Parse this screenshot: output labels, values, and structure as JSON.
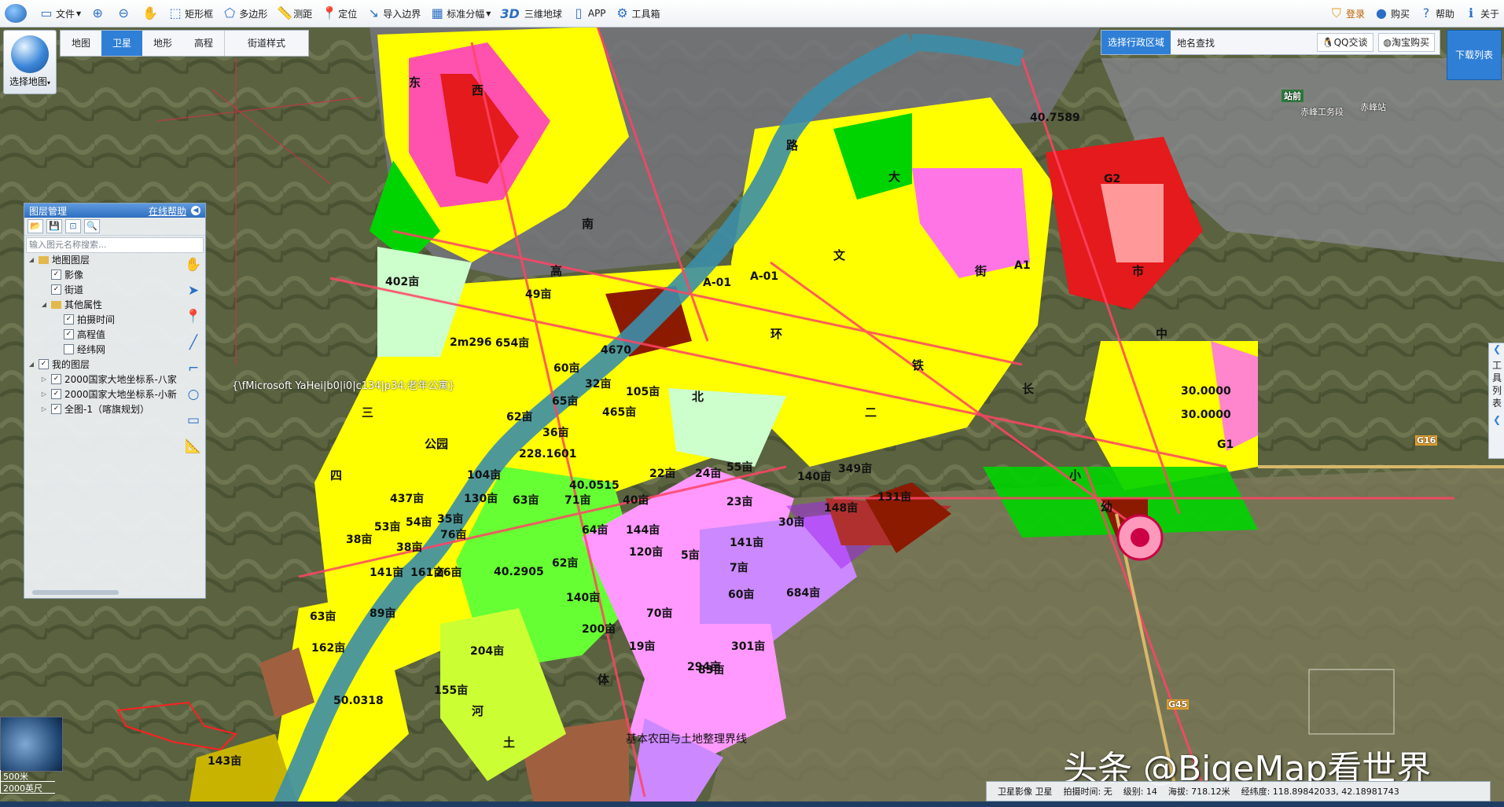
{
  "toolbar": {
    "file": "文件",
    "rect": "矩形框",
    "polygon": "多边形",
    "measure": "测距",
    "locate": "定位",
    "import_border": "导入边界",
    "standard_sheet": "标准分幅",
    "three_d_badge": "3D",
    "three_d_globe": "三维地球",
    "app": "APP",
    "toolbox": "工具箱",
    "login": "登录",
    "buy": "购买",
    "help": "帮助",
    "about": "关于"
  },
  "select_map": "选择地图",
  "map_tabs": [
    "地图",
    "卫星",
    "地形",
    "高程"
  ],
  "active_map_tab": "卫星",
  "street_style": "街道样式",
  "region_bar": {
    "select_region": "选择行政区域",
    "place_search": "地名查找",
    "qq_chat": "QQ交谈",
    "taobao_buy": "淘宝购买"
  },
  "download_list": "下载列表",
  "layer_panel": {
    "title": "图层管理",
    "online_help": "在线帮助",
    "search_placeholder": "输入图元名称搜索...",
    "items": [
      {
        "label": "地图图层",
        "level": 0,
        "checkbox": false,
        "expanded": true
      },
      {
        "label": "影像",
        "level": 1,
        "checkbox": true,
        "checked": true
      },
      {
        "label": "街道",
        "level": 1,
        "checkbox": true,
        "checked": true
      },
      {
        "label": "其他属性",
        "level": 1,
        "checkbox": false,
        "expanded": true
      },
      {
        "label": "拍摄时间",
        "level": 2,
        "checkbox": true,
        "checked": true
      },
      {
        "label": "高程值",
        "level": 2,
        "checkbox": true,
        "checked": true
      },
      {
        "label": "经纬网",
        "level": 2,
        "checkbox": true,
        "checked": false
      },
      {
        "label": "我的图层",
        "level": 0,
        "checkbox": true,
        "checked": true,
        "expanded": true
      },
      {
        "label": "2000国家大地坐标系-八家",
        "level": 1,
        "checkbox": true,
        "checked": true
      },
      {
        "label": "2000国家大地坐标系-小新",
        "level": 1,
        "checkbox": true,
        "checked": true
      },
      {
        "label": "全图-1（喀旗规划）",
        "level": 1,
        "checkbox": true,
        "checked": true
      }
    ]
  },
  "tool_list": "工具列表",
  "scale": {
    "metric": "500米",
    "imperial": "2000英尺"
  },
  "status": {
    "imagery": "卫星影像 卫星",
    "capture_time": "拍摄时间: 无",
    "level": "级别: 14",
    "elevation": "海拔: 718.12米",
    "coords": "经纬度: 118.89842033, 42.18981743"
  },
  "watermark": "头条 @BigeMap看世界",
  "map_labels": {
    "font_debug": "{\\fMicrosoft YaHei|b0|i0|c134|p34;老年公寓}",
    "boundary_line": "基本农田与土地整理界线",
    "coord_1": "40.7589",
    "coord_2": "40.0515",
    "coord_3": "40.2905",
    "coord_4": "50.0318",
    "num_1": "4670",
    "num_2": "228.1601",
    "num_3": "30.0000",
    "num_4": "30.0000",
    "zone_a01": "A-01",
    "zone_a01b": "A-01",
    "zone_g1": "G1",
    "zone_g2": "G2",
    "zone_a1": "A1",
    "mu": [
      "402亩",
      "49亩",
      "2m296",
      "654亩",
      "60亩",
      "32亩",
      "105亩",
      "65亩",
      "465亩",
      "62亩",
      "36亩",
      "104亩",
      "130亩",
      "63亩",
      "22亩",
      "24亩",
      "55亩",
      "140亩",
      "349亩",
      "131亩",
      "148亩",
      "437亩",
      "54亩",
      "35亩",
      "40亩",
      "30亩",
      "141亩",
      "144亩",
      "64亩",
      "53亩",
      "38亩",
      "120亩",
      "62亩",
      "76亩",
      "26亩",
      "5亩",
      "7亩",
      "141亩",
      "161亩",
      "140亩",
      "70亩",
      "60亩",
      "63亩",
      "89亩",
      "204亩",
      "200亩",
      "19亩",
      "83亩",
      "162亩",
      "155亩",
      "294亩",
      "301亩",
      "143亩",
      "23亩",
      "71亩",
      "38亩",
      "684亩"
    ],
    "roads": [
      "东",
      "西",
      "南",
      "北",
      "路",
      "大",
      "街",
      "文",
      "环",
      "铁",
      "长",
      "市",
      "中",
      "小",
      "幼",
      "高",
      "体",
      "土",
      "河",
      "公园",
      "四",
      "三",
      "二"
    ],
    "highway_g16": "G16",
    "highway_g45": "G45",
    "station": "站前",
    "chifeng_south": "赤峰工务段",
    "chifeng_station": "赤峰站"
  }
}
